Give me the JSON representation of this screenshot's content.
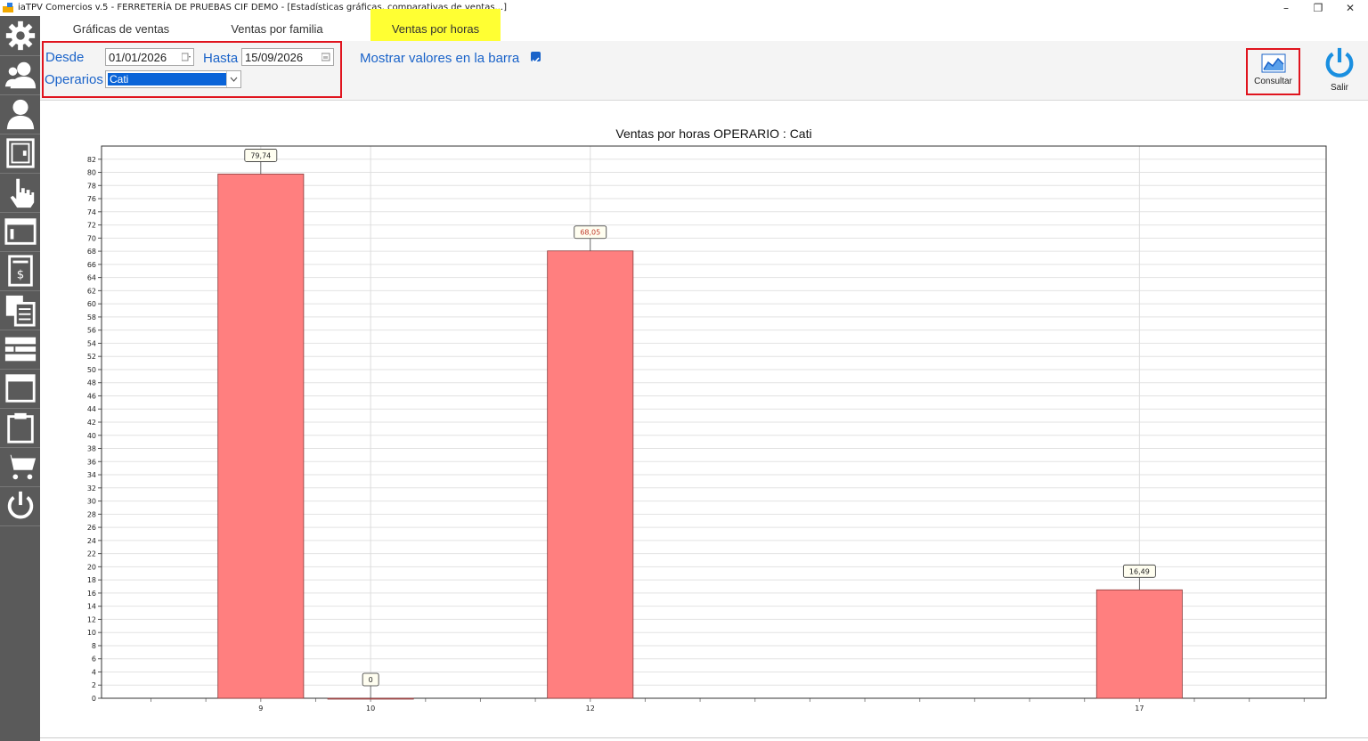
{
  "window": {
    "title": "iaTPV Comercios v.5 - FERRETERÍA DE PRUEBAS CIF DEMO - [Estadísticas gráficas, comparativas de ventas...]",
    "minimize": "–",
    "restore": "❐",
    "close": "✕"
  },
  "tabs": [
    {
      "label": "Gráficas de ventas"
    },
    {
      "label": "Ventas por familia"
    },
    {
      "label": "Ventas por horas"
    }
  ],
  "filters": {
    "desde_label": "Desde",
    "desde_value": "01/01/2026",
    "hasta_label": "Hasta",
    "hasta_value": "15/09/2026",
    "operarios_label": "Operarios",
    "operarios_value": "Cati",
    "mostrar_label": "Mostrar valores en la barra"
  },
  "buttons": {
    "consultar": "Consultar",
    "salir": "Salir"
  },
  "colors": {
    "bar": "#ff7f7f",
    "accent": "#1a63c9",
    "tab_active": "#ffff33",
    "highlight": "#e0141e"
  },
  "sidebar": {
    "icons": [
      "gear-icon",
      "user-group-icon",
      "user-icon",
      "safe-icon",
      "hand-pointer-icon",
      "window-icon",
      "invoice-icon",
      "documents-icon",
      "forklift-icon",
      "panel-icon",
      "clipboard-icon",
      "cart-icon",
      "power-icon"
    ]
  },
  "chart_data": {
    "type": "bar",
    "title": "Ventas por horas  OPERARIO : Cati",
    "categories": [
      "9",
      "10",
      "12",
      "17"
    ],
    "x": [
      9,
      10,
      12,
      17
    ],
    "values": [
      79.74,
      0,
      68.05,
      16.49
    ],
    "value_labels": [
      "79,74",
      "0",
      "68,05",
      "16,49"
    ],
    "xlim": [
      7.55,
      18.7
    ],
    "ylim": [
      0,
      84
    ],
    "ytick_step": 2,
    "grid": true
  }
}
